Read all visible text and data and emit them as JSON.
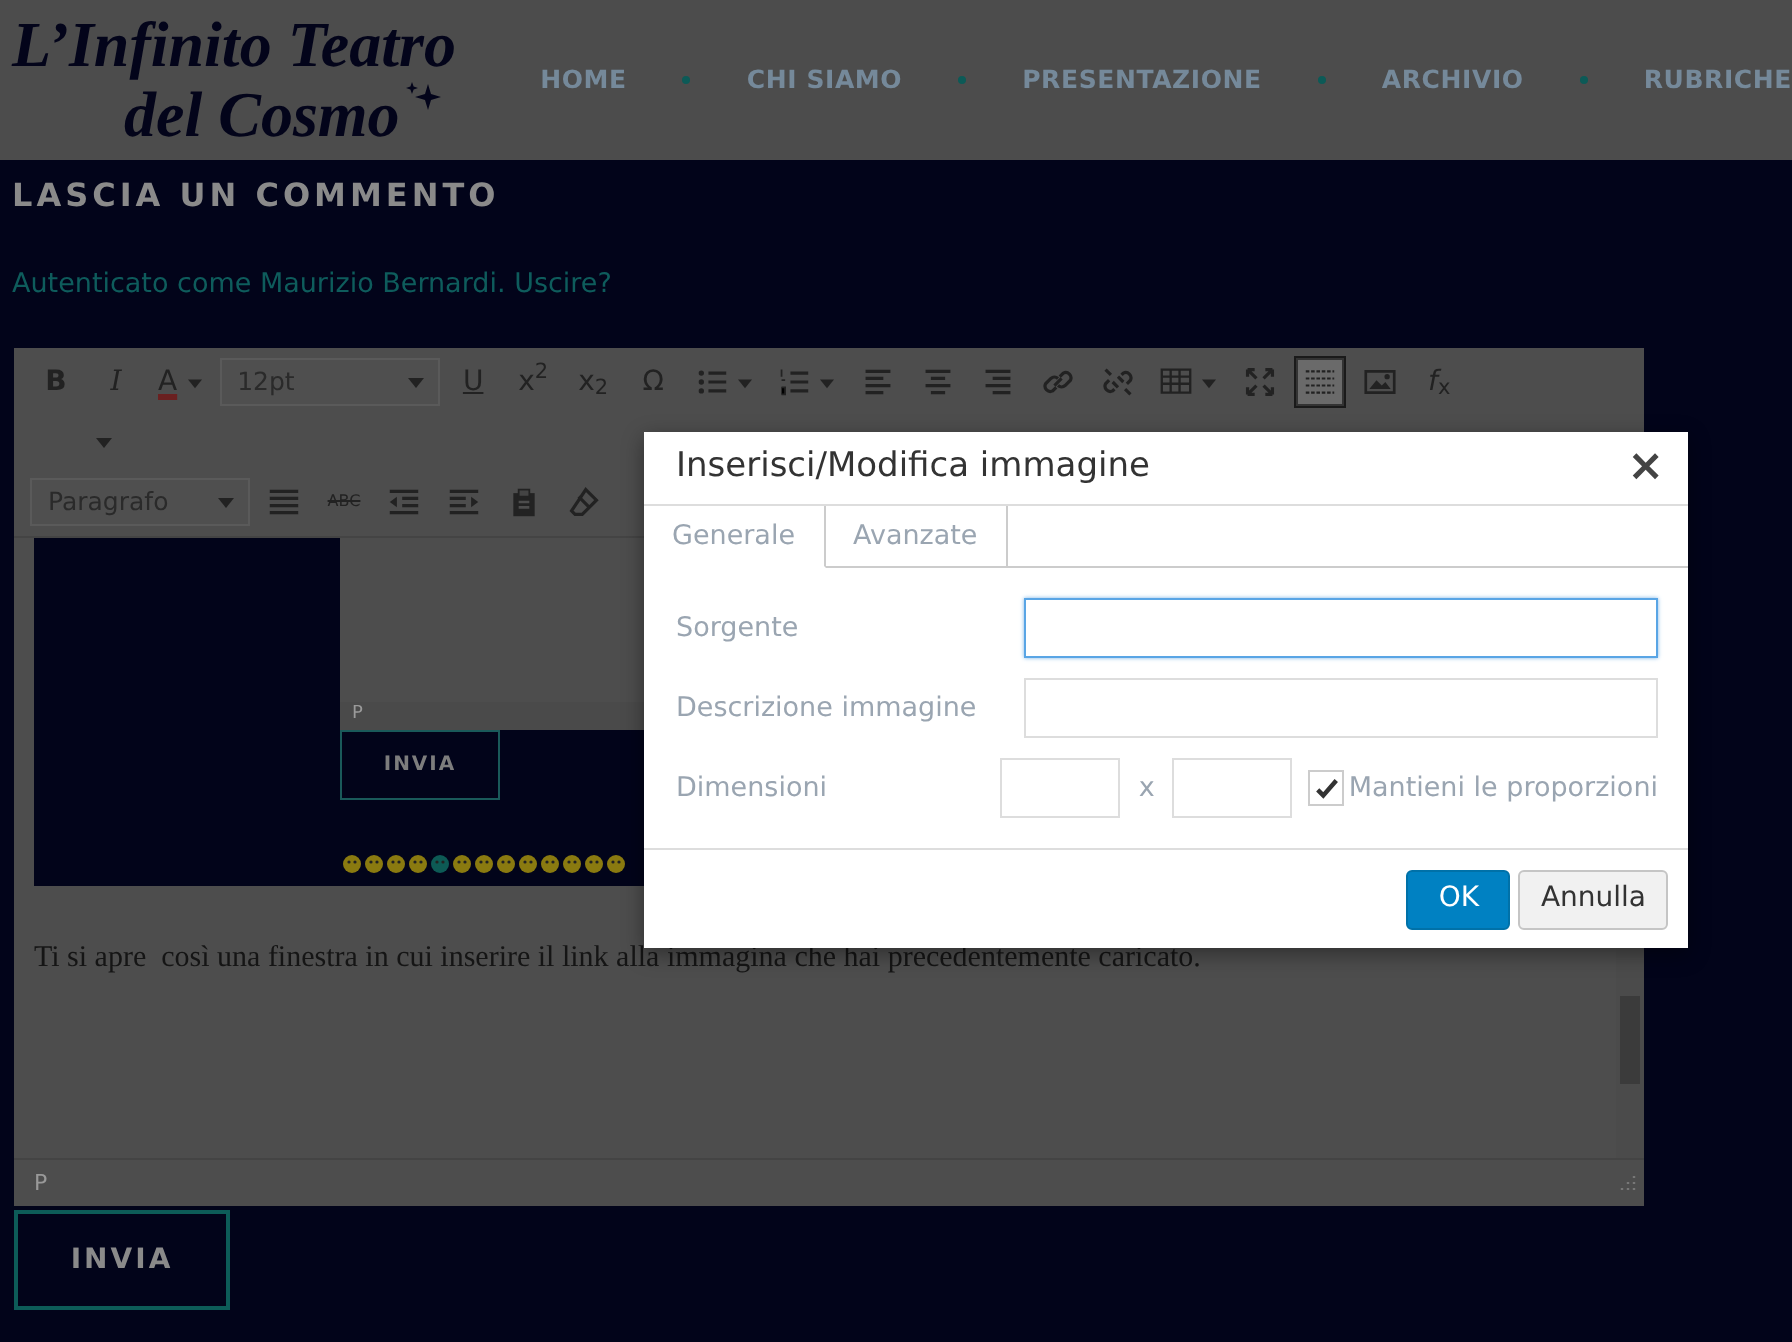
{
  "site": {
    "logo_lines": [
      "L’Infinito Teatro",
      "del Cosmo"
    ],
    "nav": [
      {
        "label": "HOME"
      },
      {
        "label": "CHI SIAMO"
      },
      {
        "label": "PRESENTAZIONE"
      },
      {
        "label": "ARCHIVIO"
      },
      {
        "label": "RUBRICHE"
      }
    ]
  },
  "comment_heading": "LASCIA UN COMMENTO",
  "login_line": {
    "user_link": "Autenticato come Maurizio Bernardi",
    "separator": ".",
    "logout_link": "Uscire?"
  },
  "editor": {
    "toolbar_rows": [
      [
        {
          "kind": "bold",
          "label": "B",
          "active": false
        },
        {
          "kind": "italic",
          "label": "I",
          "active": false
        },
        {
          "kind": "text-color",
          "label": "A",
          "active": false
        },
        {
          "kind": "select",
          "value": "12pt"
        },
        {
          "kind": "underline",
          "label": "U",
          "active": false
        },
        {
          "kind": "symbol",
          "label": "x$^{2}$",
          "active": false
        },
        {
          "kind": "symbol",
          "label": "x$_{2}$",
          "active": false
        },
        {
          "kind": "symbol",
          "label": "Ω",
          "active": false
        },
        {
          "kind": "bullet-list",
          "active": false
        },
        {
          "kind": "numbered-list",
          "active": false
        },
        {
          "kind": "align-left",
          "active": false
        },
        {
          "kind": "align-center",
          "active": false
        },
        {
          "kind": "align-right",
          "active": false
        },
        {
          "kind": "link",
          "active": false
        },
        {
          "kind": "unlink",
          "active": false
        },
        {
          "kind": "table",
          "active": false
        },
        {
          "kind": "fullscreen",
          "active": false
        },
        {
          "kind": "visual-blocks",
          "active": true
        },
        {
          "kind": "image",
          "active": false
        },
        {
          "kind": "symbol",
          "label": "*f*$_{x}$",
          "active": false
        }
      ],
      [
        {
          "kind": "caret"
        }
      ],
      [
        {
          "kind": "select",
          "value": "Paragrafo"
        },
        {
          "kind": "justify",
          "active": false
        },
        {
          "kind": "strikethrough",
          "label": "ABC",
          "active": false
        },
        {
          "kind": "outdent",
          "active": false
        },
        {
          "kind": "indent",
          "active": false
        },
        {
          "kind": "paste",
          "active": false
        },
        {
          "kind": "eraser",
          "active": false
        }
      ]
    ],
    "content": {
      "embedded_screenshot": {
        "status_path": "P",
        "submit_label": "INVIA"
      },
      "paragraph": "Ti si apre  così una finestra in cui inserire il link alla immagina che hai precedentemente caricato."
    },
    "status_path": "P"
  },
  "submit_label": "INVIA",
  "dialog": {
    "title": "Inserisci/Modifica immagine",
    "close": "×",
    "tabs": [
      {
        "label": "Generale",
        "selected": true
      },
      {
        "label": "Avanzate",
        "selected": false
      }
    ],
    "fields": [
      {
        "label": "Sorgente",
        "focused": true
      },
      {
        "label": "Descrizione immagine",
        "focused": false
      }
    ],
    "dimensions": {
      "label": "Dimensioni",
      "separator": "x",
      "constrain": {
        "label": "Mantieni le proporzioni",
        "checked": true
      }
    },
    "buttons": [
      {
        "label": "OK",
        "primary": true
      },
      {
        "label": "Annulla",
        "primary": false
      }
    ]
  }
}
